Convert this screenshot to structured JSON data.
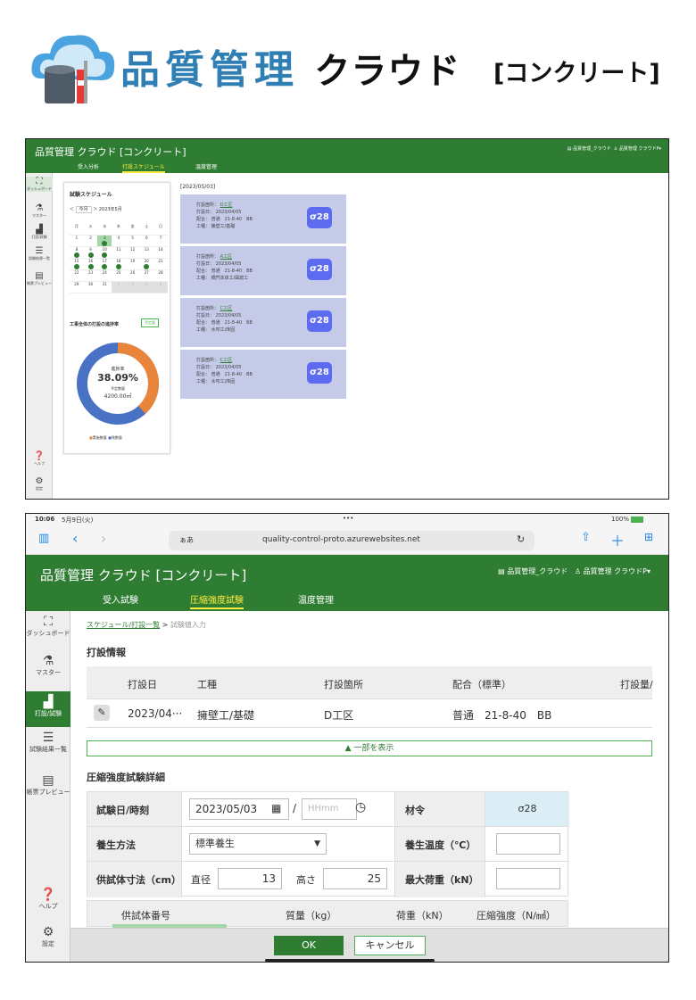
{
  "logo": {
    "title": "品質管理",
    "cloud": "クラウド",
    "sub": "[コンクリート]"
  },
  "shot1": {
    "header": {
      "brand": "品質管理 クラウド [コンクリート]",
      "right_left": "品質管理_クラウド",
      "right_user": "品質管理 クラウドP",
      "tabs": [
        "受入分析",
        "打設スケジュール",
        "温度管理"
      ],
      "active_tab": "打設スケジュール"
    },
    "sidebar": [
      {
        "icon": "dashboard-icon",
        "label": "ダッシュボード"
      },
      {
        "icon": "flask-icon",
        "label": "マスター"
      },
      {
        "icon": "pour-icon",
        "label": "打設/試験"
      },
      {
        "icon": "result-icon",
        "label": "試験結果一覧"
      },
      {
        "icon": "report-icon",
        "label": "帳票プレビュー"
      },
      {
        "icon": "help-icon",
        "label": "ヘルプ"
      },
      {
        "icon": "gear-icon",
        "label": "設定"
      }
    ],
    "calendar": {
      "title": "試験スケジュール",
      "today_btn": "今月",
      "month": "2023年5月",
      "weekdays": [
        "月",
        "火",
        "水",
        "木",
        "金",
        "土",
        "日"
      ],
      "weeks": [
        [
          {
            "d": "1"
          },
          {
            "d": "2"
          },
          {
            "d": "3",
            "sel": true,
            "dot": true
          },
          {
            "d": "4"
          },
          {
            "d": "5"
          },
          {
            "d": "6"
          },
          {
            "d": "7"
          }
        ],
        [
          {
            "d": "8",
            "dot": true
          },
          {
            "d": "9",
            "dot": true
          },
          {
            "d": "10",
            "dot": true
          },
          {
            "d": "11"
          },
          {
            "d": "12"
          },
          {
            "d": "13"
          },
          {
            "d": "14"
          }
        ],
        [
          {
            "d": "15",
            "dot": true
          },
          {
            "d": "16",
            "dot": true
          },
          {
            "d": "17",
            "dot": true
          },
          {
            "d": "18",
            "dot": true
          },
          {
            "d": "19"
          },
          {
            "d": "20",
            "dot": true
          },
          {
            "d": "21"
          }
        ],
        [
          {
            "d": "22"
          },
          {
            "d": "23"
          },
          {
            "d": "24"
          },
          {
            "d": "25"
          },
          {
            "d": "26"
          },
          {
            "d": "27"
          },
          {
            "d": "28"
          }
        ],
        [
          {
            "d": "29"
          },
          {
            "d": "30"
          },
          {
            "d": "31"
          },
          {
            "d": "1",
            "grey": true
          },
          {
            "d": "2",
            "grey": true
          },
          {
            "d": "3",
            "grey": true
          },
          {
            "d": "4",
            "grey": true
          }
        ]
      ]
    },
    "progress": {
      "title": "工事全体の打設の進捗率",
      "button": "予定量",
      "label": "進捗率",
      "percent": "38.09%",
      "value": 0.3809,
      "planned_label": "予定数量",
      "planned_value": "4200.00㎥",
      "legend_done": "実施数量",
      "legend_remaining": "残数量",
      "color_done": "#e9853a",
      "color_remaining": "#4a72c4"
    },
    "date_header": "[2023/05/03]",
    "cards": [
      {
        "place_label": "打設箇所：",
        "place": "D工区",
        "date_label": "打設日：",
        "date": "2023/04/05",
        "mix_label": "配合：",
        "mix": "普通　21-8-40　BB",
        "work_label": "工種：",
        "work": "擁壁工/基礎",
        "badge": "σ28"
      },
      {
        "place_label": "打設箇所：",
        "place": "A工区",
        "date_label": "打設日：",
        "date": "2023/04/05",
        "mix_label": "配合：",
        "mix": "普通　21-8-40　BB",
        "work_label": "工種：",
        "work": "橋門本体工/図腐工",
        "badge": "σ28"
      },
      {
        "place_label": "打設箇所：",
        "place": "C工区",
        "date_label": "打設日：",
        "date": "2023/04/05",
        "mix_label": "配合：",
        "mix": "普通　21-8-40　BB",
        "work_label": "工種：",
        "work": "水叩工/床固",
        "badge": "σ28"
      },
      {
        "place_label": "打設箇所：",
        "place": "C工区",
        "date_label": "打設日：",
        "date": "2023/04/05",
        "mix_label": "配合：",
        "mix": "普通　21-8-40　BB",
        "work_label": "工種：",
        "work": "水叩工/床固",
        "badge": "σ28"
      }
    ]
  },
  "shot2": {
    "status": {
      "time": "10:06",
      "date": "5月9日(火)",
      "dots": "•••",
      "battery": "100%"
    },
    "browser": {
      "aa": "ぁあ",
      "url": "quality-control-proto.azurewebsites.net"
    },
    "header": {
      "brand": "品質管理 クラウド [コンクリート]",
      "right_left": "品質管理_クラウド",
      "right_user": "品質管理 クラウドP",
      "tabs": [
        "受入試験",
        "圧縮強度試験",
        "温度管理"
      ],
      "active_tab": "圧縮強度試験"
    },
    "sidebar": [
      {
        "icon": "dashboard-icon",
        "label": "ダッシュボード"
      },
      {
        "icon": "flask-icon",
        "label": "マスター"
      },
      {
        "icon": "pour-icon",
        "label": "打設/試験"
      },
      {
        "icon": "result-icon",
        "label": "試験結果一覧"
      },
      {
        "icon": "report-icon",
        "label": "帳票プレビュー"
      },
      {
        "icon": "help-icon",
        "label": "ヘルプ"
      },
      {
        "icon": "gear-icon",
        "label": "設定"
      }
    ],
    "breadcrumb": {
      "link": "スケジュール/打設一覧",
      "sep": " > ",
      "current": "試験値入力"
    },
    "pour_section": "打設情報",
    "pour_table": {
      "headers": [
        "打設日",
        "工種",
        "打設箇所",
        "配合（標準）",
        "打設量/"
      ],
      "row": [
        "2023/04···",
        "擁壁工/基礎",
        "D工区",
        "普通　21-8-40　BB",
        ""
      ]
    },
    "toggle_label": "一部を表示",
    "detail_section": "圧縮強度試験詳細",
    "form": {
      "date_label": "試験日/時刻",
      "date_value": "2023/05/03",
      "slash": "/",
      "time_placeholder": "HHmm",
      "age_label": "材令",
      "age_value": "σ28",
      "cure_label": "養生方法",
      "cure_value": "標準養生",
      "cure_temp_label": "養生温度（℃）",
      "size_label": "供試体寸法（cm）",
      "diameter_label": "直径",
      "diameter_value": "13",
      "height_label": "高さ",
      "height_value": "25",
      "max_load_label": "最大荷重（kN）"
    },
    "specimen_headers": [
      "供試体番号",
      "質量（kg）",
      "荷重（kN）",
      "圧縮強度（N/㎟）"
    ],
    "ok_label": "OK",
    "cancel_label": "キャンセル"
  }
}
